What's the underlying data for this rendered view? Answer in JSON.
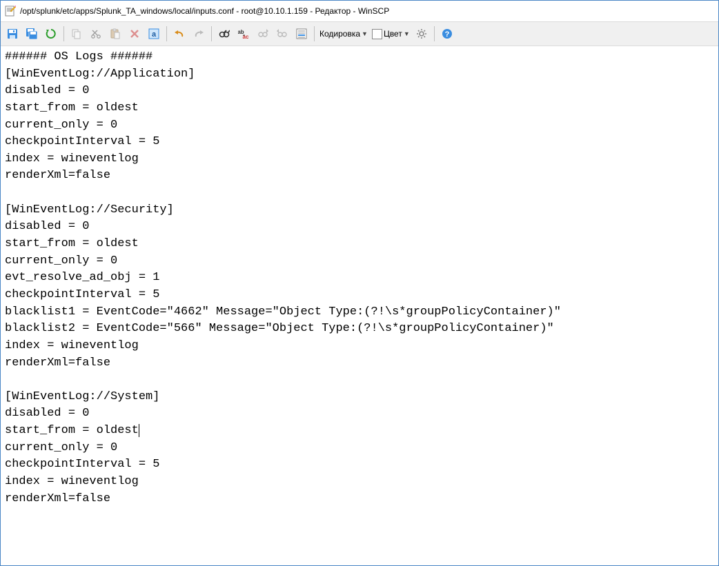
{
  "window": {
    "title": "/opt/splunk/etc/apps/Splunk_TA_windows/local/inputs.conf - root@10.10.1.159 - Редактор - WinSCP"
  },
  "toolbar": {
    "encoding_label": "Кодировка",
    "color_label": "Цвет"
  },
  "editor": {
    "lines": [
      "###### OS Logs ######",
      "[WinEventLog://Application]",
      "disabled = 0",
      "start_from = oldest",
      "current_only = 0",
      "checkpointInterval = 5",
      "index = wineventlog",
      "renderXml=false",
      "",
      "[WinEventLog://Security]",
      "disabled = 0",
      "start_from = oldest",
      "current_only = 0",
      "evt_resolve_ad_obj = 1",
      "checkpointInterval = 5",
      "blacklist1 = EventCode=\"4662\" Message=\"Object Type:(?!\\s*groupPolicyContainer)\"",
      "blacklist2 = EventCode=\"566\" Message=\"Object Type:(?!\\s*groupPolicyContainer)\"",
      "index = wineventlog",
      "renderXml=false",
      "",
      "[WinEventLog://System]",
      "disabled = 0",
      "start_from = oldest",
      "current_only = 0",
      "checkpointInterval = 5",
      "index = wineventlog",
      "renderXml=false"
    ],
    "cursor_line": 22
  }
}
